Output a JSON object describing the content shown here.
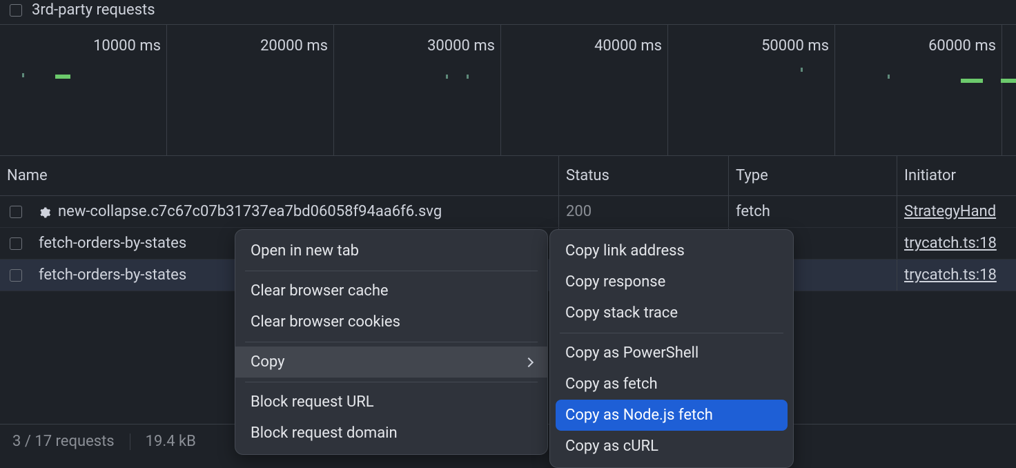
{
  "filter": {
    "third_party_label": "3rd-party requests"
  },
  "timeline": {
    "ticks": [
      "10000 ms",
      "20000 ms",
      "30000 ms",
      "40000 ms",
      "50000 ms",
      "60000 ms"
    ]
  },
  "columns": {
    "name": "Name",
    "status": "Status",
    "type": "Type",
    "initiator": "Initiator"
  },
  "rows": [
    {
      "name": "new-collapse.c7c67c07b31737ea7bd06058f94aa6f6.svg",
      "status": "200",
      "type": "fetch",
      "initiator": "StrategyHand",
      "has_gear": true,
      "selected": false
    },
    {
      "name": "fetch-orders-by-states",
      "status": "",
      "type": "",
      "initiator": "trycatch.ts:18",
      "has_gear": false,
      "selected": false
    },
    {
      "name": "fetch-orders-by-states",
      "status": "",
      "type": "",
      "initiator": "trycatch.ts:18",
      "has_gear": false,
      "selected": true
    }
  ],
  "context_menu": {
    "open_new_tab": "Open in new tab",
    "clear_cache": "Clear browser cache",
    "clear_cookies": "Clear browser cookies",
    "copy": "Copy",
    "block_url": "Block request URL",
    "block_domain": "Block request domain"
  },
  "copy_submenu": {
    "link_address": "Copy link address",
    "response": "Copy response",
    "stack_trace": "Copy stack trace",
    "as_powershell": "Copy as PowerShell",
    "as_fetch": "Copy as fetch",
    "as_node_fetch": "Copy as Node.js fetch",
    "as_curl": "Copy as cURL"
  },
  "status_bar": {
    "requests": "3 / 17 requests",
    "size": "19.4 kB"
  }
}
